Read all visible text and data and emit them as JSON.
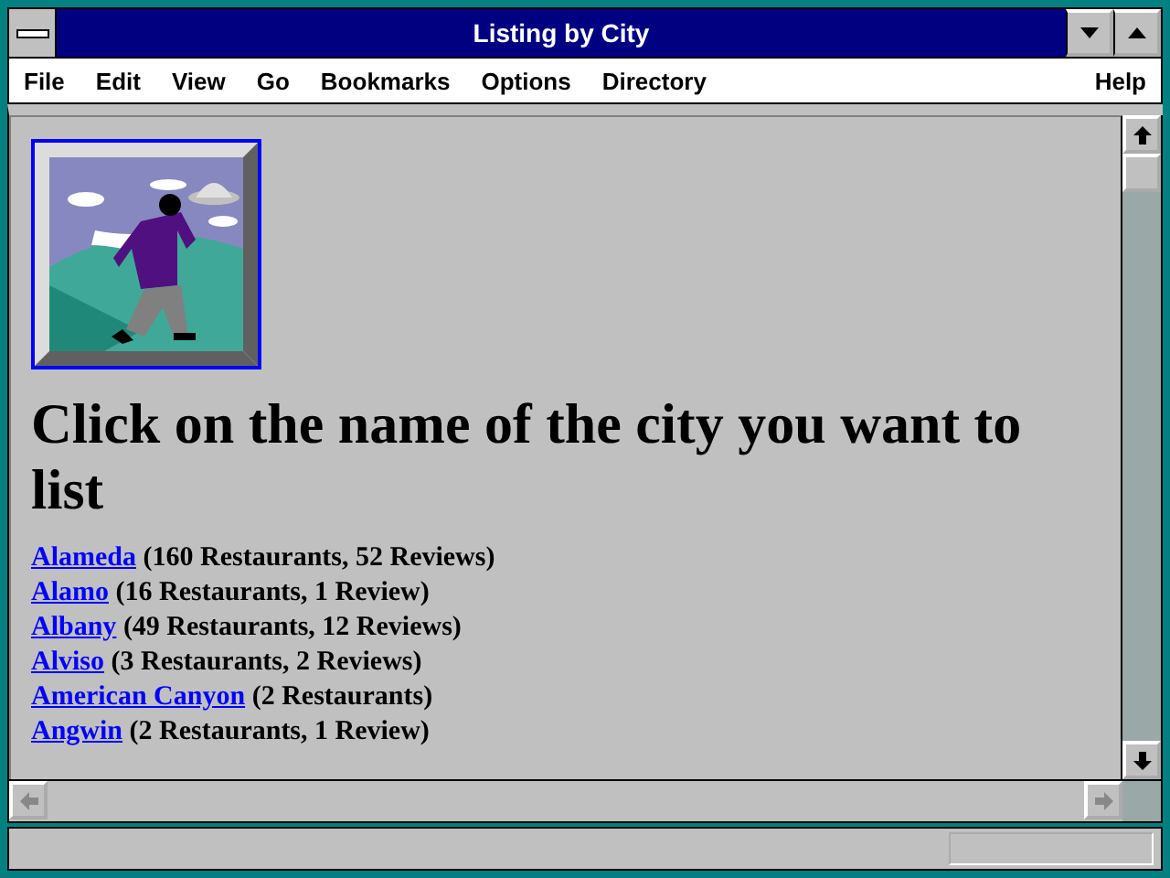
{
  "window": {
    "title": "Listing by City"
  },
  "menu": [
    {
      "label": "File"
    },
    {
      "label": "Edit"
    },
    {
      "label": "View"
    },
    {
      "label": "Go"
    },
    {
      "label": "Bookmarks"
    },
    {
      "label": "Options"
    },
    {
      "label": "Directory"
    },
    {
      "label": "Help"
    }
  ],
  "page": {
    "heading": "Click on the name of the city you want to list",
    "cities": [
      {
        "name": "Alameda",
        "info": "(160 Restaurants, 52 Reviews)"
      },
      {
        "name": "Alamo",
        "info": "(16 Restaurants, 1 Review)"
      },
      {
        "name": "Albany",
        "info": "(49 Restaurants, 12 Reviews)"
      },
      {
        "name": "Alviso",
        "info": "(3 Restaurants, 2 Reviews)"
      },
      {
        "name": "American Canyon",
        "info": "(2 Restaurants)"
      },
      {
        "name": "Angwin",
        "info": "(2 Restaurants, 1 Review)"
      }
    ]
  }
}
